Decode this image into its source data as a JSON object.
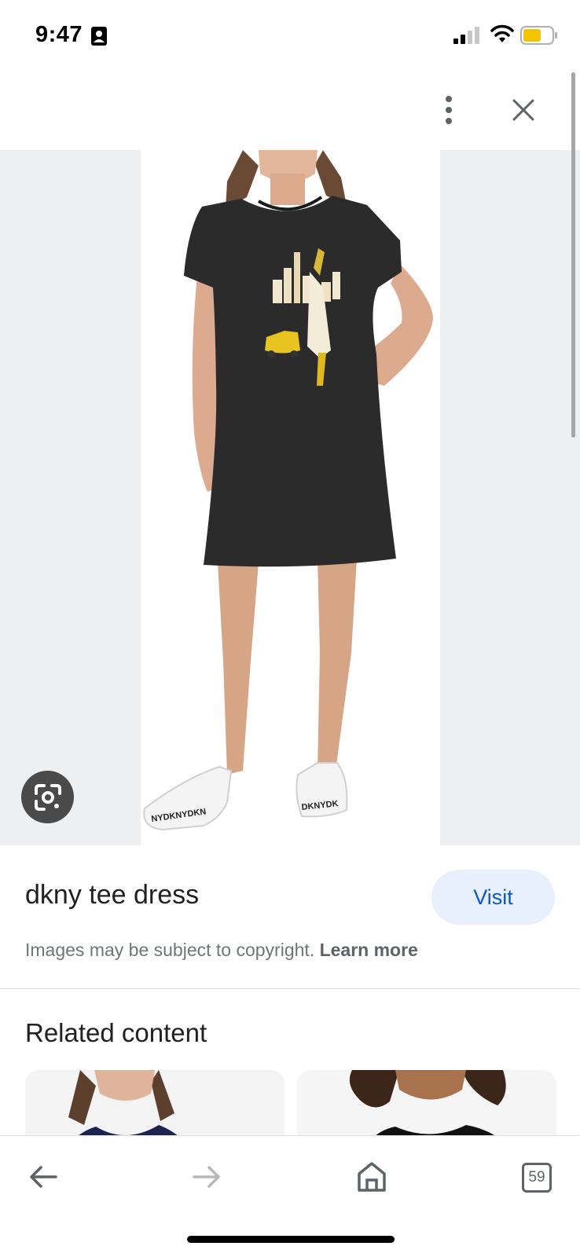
{
  "status_bar": {
    "time": "9:47",
    "icons": [
      "contact-card-icon",
      "cellular-signal-icon",
      "wifi-icon",
      "battery-low-power-icon"
    ],
    "battery_color": "#f5c400"
  },
  "toolbar": {
    "icons": [
      "more-vertical-icon",
      "close-icon"
    ]
  },
  "image": {
    "subject": "woman-in-black-tee-dress",
    "print_brand": "DKNY",
    "lens_icon": "google-lens-icon"
  },
  "result": {
    "title": "dkny tee dress",
    "visit_label": "Visit",
    "copyright_text": "Images may be subject to copyright.",
    "learn_more_label": "Learn more"
  },
  "related": {
    "heading": "Related content"
  },
  "bottom_nav": {
    "icons": [
      "back-arrow-icon",
      "forward-arrow-icon",
      "home-icon",
      "tabs-icon"
    ],
    "tab_count": "59"
  },
  "colors": {
    "accent": "#0b57d0",
    "visit_bg": "#e8f0fe",
    "secondary_text": "#70757a"
  }
}
